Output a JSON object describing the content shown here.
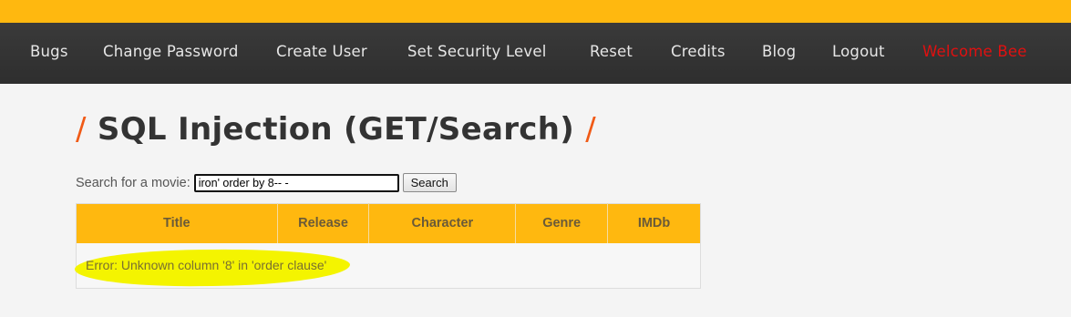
{
  "nav": {
    "items": [
      {
        "label": "Bugs"
      },
      {
        "label": "Change Password"
      },
      {
        "label": "Create User"
      },
      {
        "label": "Set Security Level"
      },
      {
        "label": "Reset"
      },
      {
        "label": "Credits"
      },
      {
        "label": "Blog"
      },
      {
        "label": "Logout"
      }
    ],
    "welcome": "Welcome Bee"
  },
  "page": {
    "title": "SQL Injection (GET/Search)",
    "slash": "/"
  },
  "search": {
    "label": "Search for a movie:",
    "value": "iron' order by 8-- -",
    "button_label": "Search"
  },
  "table": {
    "columns": [
      "Title",
      "Release",
      "Character",
      "Genre",
      "IMDb"
    ],
    "error_message": "Error: Unknown column '8' in 'order clause'"
  },
  "colors": {
    "accent": "#ffb80f",
    "nav_background": "#333333",
    "slash": "#f05a16",
    "welcome": "#e01010",
    "highlight": "#f4f400"
  }
}
